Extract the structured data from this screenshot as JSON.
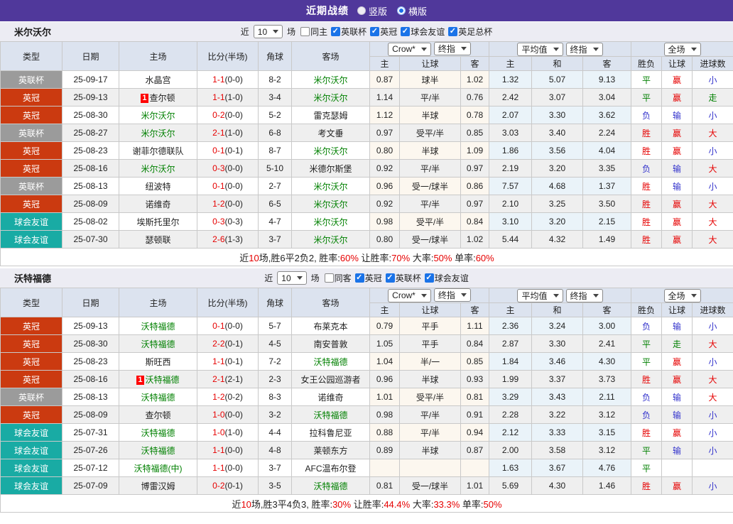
{
  "topbar": {
    "title": "近期战绩",
    "options": [
      {
        "label": "竖版",
        "checked": false
      },
      {
        "label": "横版",
        "checked": true
      }
    ]
  },
  "columns": {
    "main": [
      "类型",
      "日期",
      "主场",
      "比分(半场)",
      "角球",
      "客场"
    ],
    "sub": [
      "主",
      "让球",
      "客",
      "主",
      "和",
      "客",
      "胜负",
      "让球",
      "进球数"
    ],
    "selects": [
      "Crow*",
      "终指",
      "平均值",
      "终指",
      "全场"
    ]
  },
  "colors": {
    "accent": "#50389B",
    "checkbox_blue": "#1A73E8",
    "score_red": "#E60000",
    "team_green": "#008000",
    "summary_red": "#E60000",
    "type": {
      "gray": "#9B9B9B",
      "red": "#CB3A10",
      "teal": "#19ABA4"
    },
    "results": {
      "胜": "#E60000",
      "平": "#008000",
      "负": "#3333CC",
      "赢": "#E60000",
      "走": "#008000",
      "输": "#3333CC",
      "大": "#E60000",
      "小": "#3333CC"
    }
  },
  "sections": [
    {
      "team": "米尔沃尔",
      "filter": {
        "prefix": "近",
        "count": "10",
        "suffix": "场",
        "same_label": "同主",
        "same_checked": false,
        "leagues": [
          "英联杯",
          "英冠",
          "球会友谊",
          "英足总杯"
        ]
      },
      "rows": [
        {
          "type": "英联杯",
          "tc": "gray",
          "date": "25-09-17",
          "home": {
            "name": "水晶宫"
          },
          "ft": "1-1",
          "ht": "(0-0)",
          "corner": "8-2",
          "away": {
            "name": "米尔沃尔",
            "green": true
          },
          "odds": [
            "0.87",
            "球半",
            "1.02"
          ],
          "avg": [
            "1.32",
            "5.07",
            "9.13"
          ],
          "res": [
            "平",
            "赢",
            "小"
          ]
        },
        {
          "type": "英冠",
          "tc": "red",
          "date": "25-09-13",
          "home": {
            "name": "查尔顿",
            "badge": "1"
          },
          "ft": "1-1",
          "ht": "(1-0)",
          "corner": "3-4",
          "away": {
            "name": "米尔沃尔",
            "green": true
          },
          "odds": [
            "1.14",
            "平/半",
            "0.76"
          ],
          "avg": [
            "2.42",
            "3.07",
            "3.04"
          ],
          "res": [
            "平",
            "赢",
            "走"
          ]
        },
        {
          "type": "英冠",
          "tc": "red",
          "date": "25-08-30",
          "home": {
            "name": "米尔沃尔",
            "green": true
          },
          "ft": "0-2",
          "ht": "(0-0)",
          "corner": "5-2",
          "away": {
            "name": "雷克瑟姆"
          },
          "odds": [
            "1.12",
            "半球",
            "0.78"
          ],
          "avg": [
            "2.07",
            "3.30",
            "3.62"
          ],
          "res": [
            "负",
            "输",
            "小"
          ]
        },
        {
          "type": "英联杯",
          "tc": "gray",
          "date": "25-08-27",
          "home": {
            "name": "米尔沃尔",
            "green": true
          },
          "ft": "2-1",
          "ht": "(1-0)",
          "corner": "6-8",
          "away": {
            "name": "考文垂"
          },
          "odds": [
            "0.97",
            "受平/半",
            "0.85"
          ],
          "avg": [
            "3.03",
            "3.40",
            "2.24"
          ],
          "res": [
            "胜",
            "赢",
            "大"
          ]
        },
        {
          "type": "英冠",
          "tc": "red",
          "date": "25-08-23",
          "home": {
            "name": "谢菲尔德联队"
          },
          "ft": "0-1",
          "ht": "(0-1)",
          "corner": "8-7",
          "away": {
            "name": "米尔沃尔",
            "green": true
          },
          "odds": [
            "0.80",
            "半球",
            "1.09"
          ],
          "avg": [
            "1.86",
            "3.56",
            "4.04"
          ],
          "res": [
            "胜",
            "赢",
            "小"
          ]
        },
        {
          "type": "英冠",
          "tc": "red",
          "date": "25-08-16",
          "home": {
            "name": "米尔沃尔",
            "green": true
          },
          "ft": "0-3",
          "ht": "(0-0)",
          "corner": "5-10",
          "away": {
            "name": "米德尔斯堡"
          },
          "odds": [
            "0.92",
            "平/半",
            "0.97"
          ],
          "avg": [
            "2.19",
            "3.20",
            "3.35"
          ],
          "res": [
            "负",
            "输",
            "大"
          ]
        },
        {
          "type": "英联杯",
          "tc": "gray",
          "date": "25-08-13",
          "home": {
            "name": "纽波特"
          },
          "ft": "0-1",
          "ht": "(0-0)",
          "corner": "2-7",
          "away": {
            "name": "米尔沃尔",
            "green": true
          },
          "odds": [
            "0.96",
            "受一/球半",
            "0.86"
          ],
          "avg": [
            "7.57",
            "4.68",
            "1.37"
          ],
          "res": [
            "胜",
            "输",
            "小"
          ]
        },
        {
          "type": "英冠",
          "tc": "red",
          "date": "25-08-09",
          "home": {
            "name": "诺维奇"
          },
          "ft": "1-2",
          "ht": "(0-0)",
          "corner": "6-5",
          "away": {
            "name": "米尔沃尔",
            "green": true
          },
          "odds": [
            "0.92",
            "平/半",
            "0.97"
          ],
          "avg": [
            "2.10",
            "3.25",
            "3.50"
          ],
          "res": [
            "胜",
            "赢",
            "大"
          ]
        },
        {
          "type": "球会友谊",
          "tc": "teal",
          "date": "25-08-02",
          "home": {
            "name": "埃斯托里尔"
          },
          "ft": "0-3",
          "ht": "(0-3)",
          "corner": "4-7",
          "away": {
            "name": "米尔沃尔",
            "green": true
          },
          "odds": [
            "0.98",
            "受平/半",
            "0.84"
          ],
          "avg": [
            "3.10",
            "3.20",
            "2.15"
          ],
          "res": [
            "胜",
            "赢",
            "大"
          ]
        },
        {
          "type": "球会友谊",
          "tc": "teal",
          "date": "25-07-30",
          "home": {
            "name": "瑟顿联"
          },
          "ft": "2-6",
          "ht": "(1-3)",
          "corner": "3-7",
          "away": {
            "name": "米尔沃尔",
            "green": true
          },
          "odds": [
            "0.80",
            "受一/球半",
            "1.02"
          ],
          "avg": [
            "5.44",
            "4.32",
            "1.49"
          ],
          "res": [
            "胜",
            "赢",
            "大"
          ]
        }
      ],
      "summary": [
        {
          "t": "近"
        },
        {
          "t": "10",
          "red": true
        },
        {
          "t": "场,胜6平2负2, 胜率:"
        },
        {
          "t": "60%",
          "red": true
        },
        {
          "t": " 让胜率:"
        },
        {
          "t": "70%",
          "red": true
        },
        {
          "t": " 大率:"
        },
        {
          "t": "50%",
          "red": true
        },
        {
          "t": " 单率:"
        },
        {
          "t": "60%",
          "red": true
        }
      ]
    },
    {
      "team": "沃特福德",
      "filter": {
        "prefix": "近",
        "count": "10",
        "suffix": "场",
        "same_label": "同客",
        "same_checked": false,
        "leagues": [
          "英冠",
          "英联杯",
          "球会友谊"
        ]
      },
      "rows": [
        {
          "type": "英冠",
          "tc": "red",
          "date": "25-09-13",
          "home": {
            "name": "沃特福德",
            "green": true
          },
          "ft": "0-1",
          "ht": "(0-0)",
          "corner": "5-7",
          "away": {
            "name": "布莱克本"
          },
          "odds": [
            "0.79",
            "平手",
            "1.11"
          ],
          "avg": [
            "2.36",
            "3.24",
            "3.00"
          ],
          "res": [
            "负",
            "输",
            "小"
          ]
        },
        {
          "type": "英冠",
          "tc": "red",
          "date": "25-08-30",
          "home": {
            "name": "沃特福德",
            "green": true
          },
          "ft": "2-2",
          "ht": "(0-1)",
          "corner": "4-5",
          "away": {
            "name": "南安普敦"
          },
          "odds": [
            "1.05",
            "平手",
            "0.84"
          ],
          "avg": [
            "2.87",
            "3.30",
            "2.41"
          ],
          "res": [
            "平",
            "走",
            "大"
          ]
        },
        {
          "type": "英冠",
          "tc": "red",
          "date": "25-08-23",
          "home": {
            "name": "斯旺西"
          },
          "ft": "1-1",
          "ht": "(0-1)",
          "corner": "7-2",
          "away": {
            "name": "沃特福德",
            "green": true
          },
          "odds": [
            "1.04",
            "半/一",
            "0.85"
          ],
          "avg": [
            "1.84",
            "3.46",
            "4.30"
          ],
          "res": [
            "平",
            "赢",
            "小"
          ]
        },
        {
          "type": "英冠",
          "tc": "red",
          "date": "25-08-16",
          "home": {
            "name": "沃特福德",
            "green": true,
            "badge": "1"
          },
          "ft": "2-1",
          "ht": "(2-1)",
          "corner": "2-3",
          "away": {
            "name": "女王公园巡游者"
          },
          "odds": [
            "0.96",
            "半球",
            "0.93"
          ],
          "avg": [
            "1.99",
            "3.37",
            "3.73"
          ],
          "res": [
            "胜",
            "赢",
            "大"
          ]
        },
        {
          "type": "英联杯",
          "tc": "gray",
          "date": "25-08-13",
          "home": {
            "name": "沃特福德",
            "green": true
          },
          "ft": "1-2",
          "ht": "(0-2)",
          "corner": "8-3",
          "away": {
            "name": "诺维奇"
          },
          "odds": [
            "1.01",
            "受平/半",
            "0.81"
          ],
          "avg": [
            "3.29",
            "3.43",
            "2.11"
          ],
          "res": [
            "负",
            "输",
            "大"
          ]
        },
        {
          "type": "英冠",
          "tc": "red",
          "date": "25-08-09",
          "home": {
            "name": "查尔顿"
          },
          "ft": "1-0",
          "ht": "(0-0)",
          "corner": "3-2",
          "away": {
            "name": "沃特福德",
            "green": true
          },
          "odds": [
            "0.98",
            "平/半",
            "0.91"
          ],
          "avg": [
            "2.28",
            "3.22",
            "3.12"
          ],
          "res": [
            "负",
            "输",
            "小"
          ]
        },
        {
          "type": "球会友谊",
          "tc": "teal",
          "date": "25-07-31",
          "home": {
            "name": "沃特福德",
            "green": true
          },
          "ft": "1-0",
          "ht": "(1-0)",
          "corner": "4-4",
          "away": {
            "name": "拉科鲁尼亚"
          },
          "odds": [
            "0.88",
            "平/半",
            "0.94"
          ],
          "avg": [
            "2.12",
            "3.33",
            "3.15"
          ],
          "res": [
            "胜",
            "赢",
            "小"
          ]
        },
        {
          "type": "球会友谊",
          "tc": "teal",
          "date": "25-07-26",
          "home": {
            "name": "沃特福德",
            "green": true
          },
          "ft": "1-1",
          "ht": "(0-0)",
          "corner": "4-8",
          "away": {
            "name": "莱顿东方"
          },
          "odds": [
            "0.89",
            "半球",
            "0.87"
          ],
          "avg": [
            "2.00",
            "3.58",
            "3.12"
          ],
          "res": [
            "平",
            "输",
            "小"
          ]
        },
        {
          "type": "球会友谊",
          "tc": "teal",
          "date": "25-07-12",
          "home": {
            "name": "沃特福德(中)",
            "green": true
          },
          "ft": "1-1",
          "ht": "(0-0)",
          "corner": "3-7",
          "away": {
            "name": "AFC温布尔登"
          },
          "odds": [
            "",
            "",
            ""
          ],
          "avg": [
            "1.63",
            "3.67",
            "4.76"
          ],
          "res": [
            "平",
            "",
            ""
          ]
        },
        {
          "type": "球会友谊",
          "tc": "teal",
          "date": "25-07-09",
          "home": {
            "name": "博雷汉姆"
          },
          "ft": "0-2",
          "ht": "(0-1)",
          "corner": "3-5",
          "away": {
            "name": "沃特福德",
            "green": true
          },
          "odds": [
            "0.81",
            "受一/球半",
            "1.01"
          ],
          "avg": [
            "5.69",
            "4.30",
            "1.46"
          ],
          "res": [
            "胜",
            "赢",
            "小"
          ]
        }
      ],
      "summary": [
        {
          "t": "近"
        },
        {
          "t": "10",
          "red": true
        },
        {
          "t": "场,胜3平4负3, 胜率:"
        },
        {
          "t": "30%",
          "red": true
        },
        {
          "t": " 让胜率:"
        },
        {
          "t": "44.4%",
          "red": true
        },
        {
          "t": " 大率:"
        },
        {
          "t": "33.3%",
          "red": true
        },
        {
          "t": " 单率:"
        },
        {
          "t": "50%",
          "red": true
        }
      ]
    }
  ]
}
